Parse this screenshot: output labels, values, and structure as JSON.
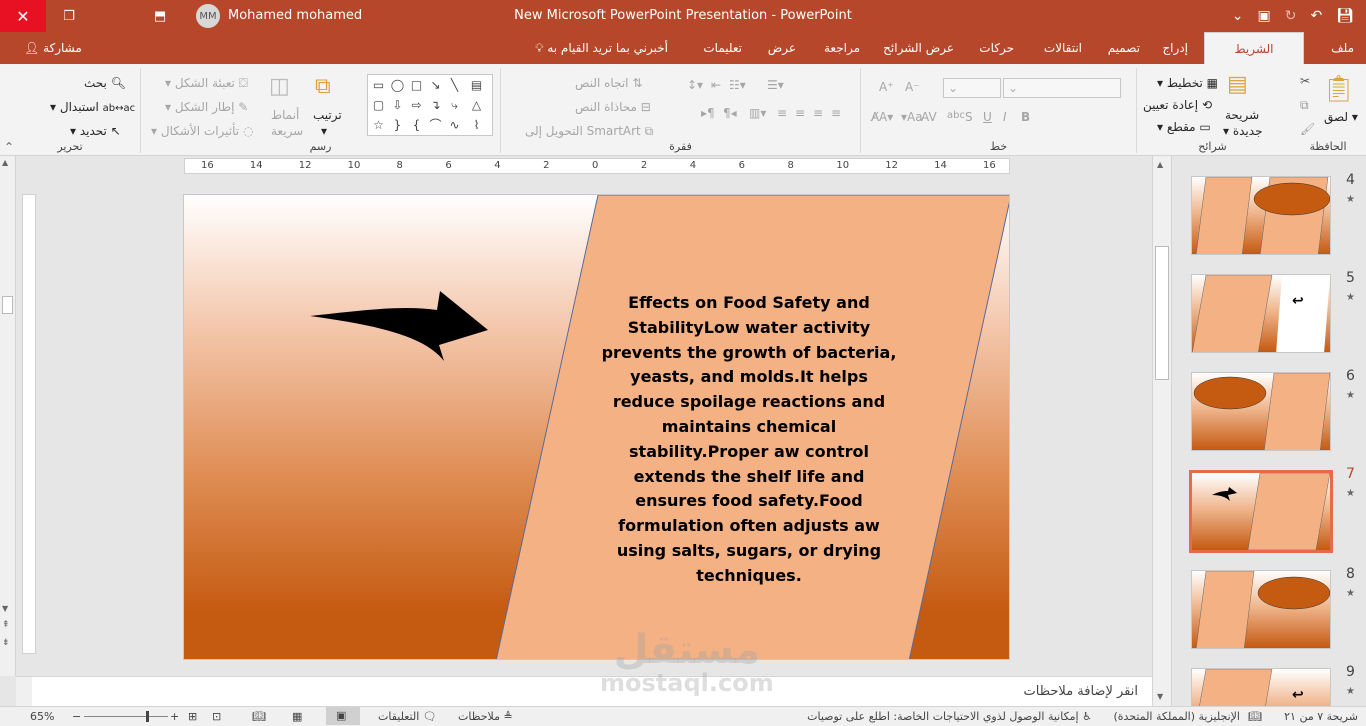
{
  "titlebar": {
    "avatar_initials": "MM",
    "user_name": "Mohamed mohamed",
    "title": "New Microsoft PowerPoint Presentation  -  PowerPoint"
  },
  "tabs": [
    {
      "label": "ملف"
    },
    {
      "label": "الشريط الرئيسي",
      "active": true
    },
    {
      "label": "إدراج"
    },
    {
      "label": "تصميم"
    },
    {
      "label": "انتقالات"
    },
    {
      "label": "حركات"
    },
    {
      "label": "عرض الشرائح"
    },
    {
      "label": "مراجعة"
    },
    {
      "label": "عرض"
    },
    {
      "label": "تعليمات"
    }
  ],
  "tell_me": "أخبرني بما تريد القيام به",
  "share": "مشاركة",
  "ribbon": {
    "clipboard": {
      "paste": "لصق",
      "label": "الحافظة"
    },
    "slides": {
      "new_slide_1": "شريحة",
      "new_slide_2": "جديدة",
      "layout": "تخطيط",
      "reset": "إعادة تعيين",
      "section": "مقطع",
      "label": "شرائح"
    },
    "font": {
      "label": "خط",
      "aa": "Aa"
    },
    "paragraph": {
      "text_direction": "اتجاه النص",
      "align_text": "محاذاة النص",
      "smartart": "التحويل إلى SmartArt",
      "label": "فقرة"
    },
    "drawing": {
      "arrange": "ترتيب",
      "quick_styles_1": "أنماط",
      "quick_styles_2": "سريعة",
      "shape_fill": "تعبئة الشكل",
      "shape_outline": "إطار الشكل",
      "shape_effects": "تأثيرات الأشكال",
      "label": "رسم"
    },
    "editing": {
      "find": "بحث",
      "replace": "استبدال",
      "select": "تحديد",
      "label": "تحرير"
    }
  },
  "ruler": {
    "ticks": [
      "16",
      "14",
      "12",
      "10",
      "8",
      "6",
      "4",
      "2",
      "0",
      "2",
      "4",
      "6",
      "8",
      "10",
      "12",
      "14",
      "16"
    ]
  },
  "slide": {
    "text": "Effects on Food Safety and StabilityLow water activity prevents the growth of bacteria, yeasts, and molds.It helps reduce spoilage reactions and maintains chemical stability.Proper aw control extends the shelf life and ensures food safety.Food formulation often adjusts aw using salts, sugars, or drying techniques.",
    "shape_color": "#f4b183",
    "arrow_color": "#000000"
  },
  "notes_placeholder": "انقر لإضافة ملاحظات",
  "thumbnails": [
    {
      "num": "4",
      "star": "★"
    },
    {
      "num": "5",
      "star": "★"
    },
    {
      "num": "6",
      "star": "★"
    },
    {
      "num": "7",
      "star": "★",
      "active": true
    },
    {
      "num": "8",
      "star": "★"
    },
    {
      "num": "9",
      "star": "★"
    }
  ],
  "status": {
    "slide_info": "شريحة ٧ من ٢١",
    "language": "الإنجليزية (المملكة المتحدة)",
    "accessibility": "إمكانية الوصول لذوي الاحتياجات الخاصة: اطلع على توصيات",
    "notes": "ملاحظات",
    "comments": "التعليقات",
    "zoom": "65%"
  },
  "watermark": {
    "line1": "مستقل",
    "line2": "mostaql.com"
  },
  "colors": {
    "accent": "#b7472a",
    "close": "#e81123",
    "active_thumb": "#e46c4b"
  }
}
